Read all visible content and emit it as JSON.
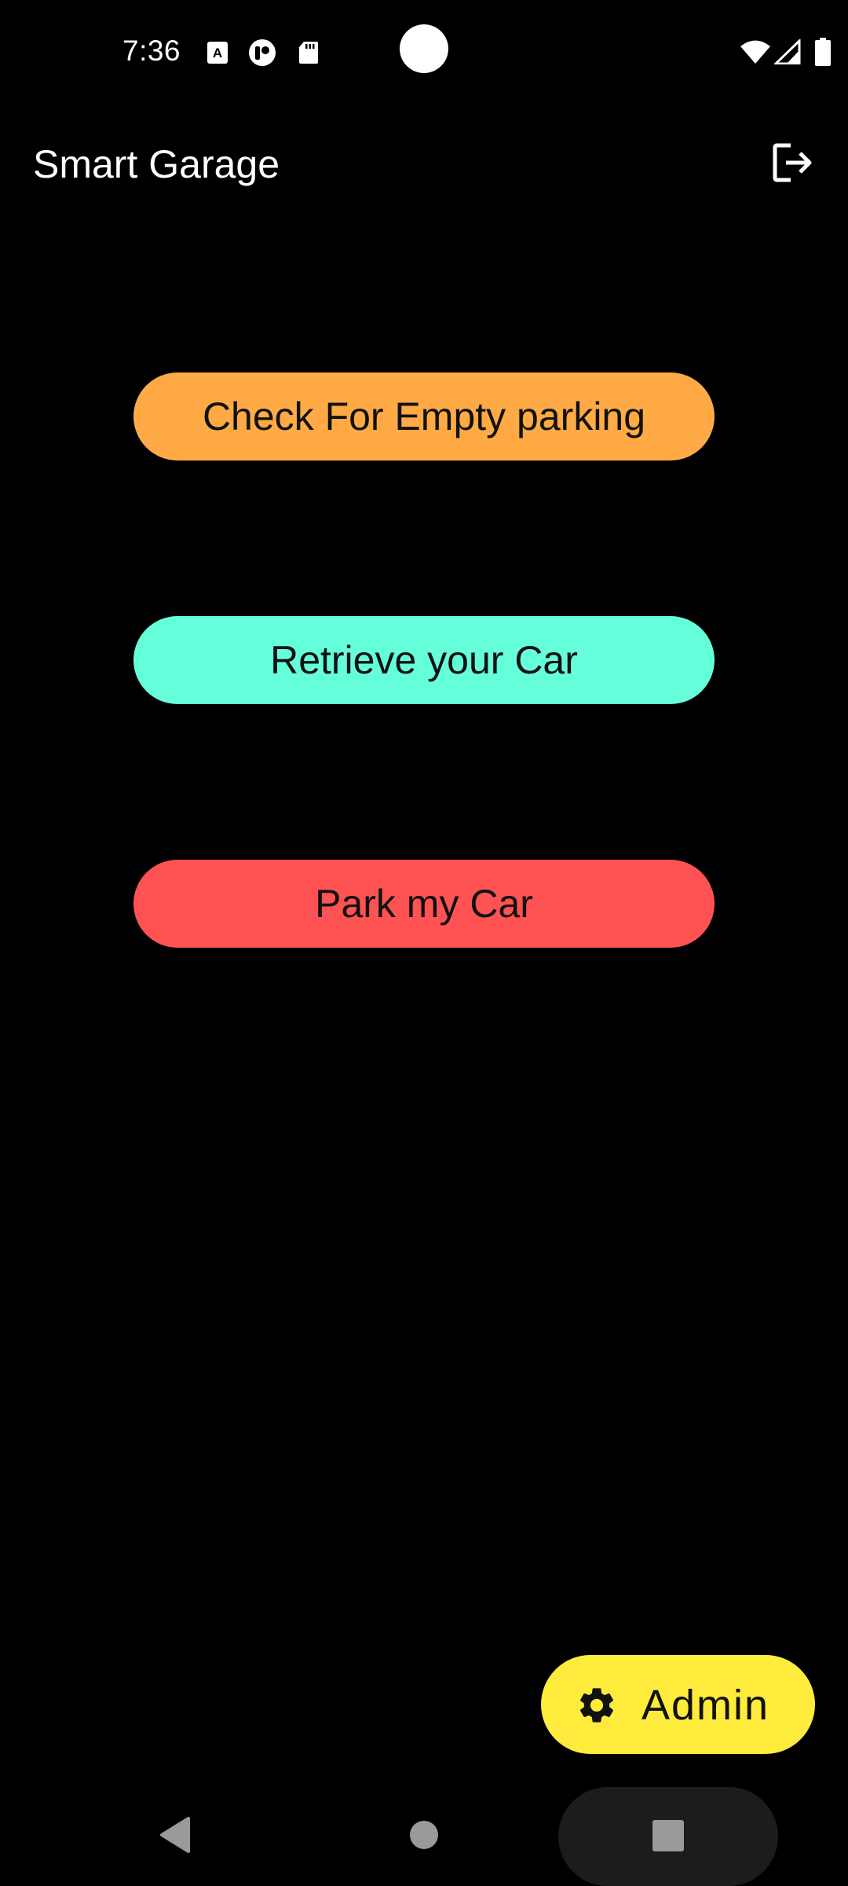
{
  "status_bar": {
    "time": "7:36",
    "left_icons": [
      "autofill-icon",
      "app-notification-icon",
      "sd-card-icon"
    ],
    "right_icons": [
      "wifi-icon",
      "signal-icon",
      "battery-icon"
    ]
  },
  "app_bar": {
    "title": "Smart Garage",
    "logout_icon": "logout-icon"
  },
  "actions": {
    "check_empty": {
      "label": "Check For Empty parking",
      "color": "#FFAA44"
    },
    "retrieve": {
      "label": "Retrieve your Car",
      "color": "#64FFDA"
    },
    "park": {
      "label": "Park my Car",
      "color": "#FF5252"
    }
  },
  "fab": {
    "label": "Admin",
    "icon": "gear-icon",
    "color": "#FFEB3B"
  },
  "nav_bar": {
    "buttons": [
      "back-icon",
      "home-icon",
      "recents-icon"
    ]
  }
}
